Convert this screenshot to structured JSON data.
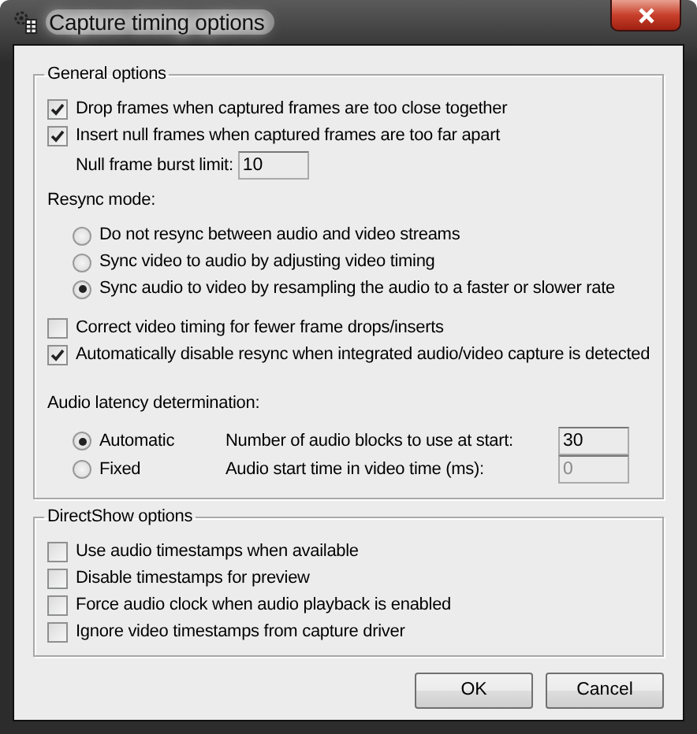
{
  "window": {
    "title": "Capture timing options"
  },
  "general_options": {
    "title": "General options",
    "checkboxes": [
      {
        "label": "Drop frames when captured frames are too close together",
        "checked": true
      },
      {
        "label": "Insert null frames when captured frames are too far apart",
        "checked": true
      }
    ],
    "burst_limit": {
      "label": "Null frame burst limit:",
      "value": "10"
    },
    "resync": {
      "label": "Resync mode:",
      "options": [
        {
          "label": "Do not resync between audio and video streams",
          "selected": false
        },
        {
          "label": "Sync video to audio by adjusting video timing",
          "selected": false
        },
        {
          "label": "Sync audio to video by resampling the audio to a faster or slower rate",
          "selected": true
        }
      ]
    },
    "more_checkboxes": [
      {
        "label": "Correct video timing for fewer frame drops/inserts",
        "checked": false
      },
      {
        "label": "Automatically disable resync when integrated audio/video capture is detected",
        "checked": true
      }
    ],
    "audio_latency": {
      "label": "Audio latency determination:",
      "options": [
        {
          "label": "Automatic",
          "selected": true,
          "field_label": "Number of audio blocks to use at start:",
          "value": "30",
          "disabled": false
        },
        {
          "label": "Fixed",
          "selected": false,
          "field_label": "Audio start time in video time (ms):",
          "value": "0",
          "disabled": true
        }
      ]
    }
  },
  "directshow_options": {
    "title": "DirectShow options",
    "checkboxes": [
      {
        "label": "Use audio timestamps when available",
        "checked": false
      },
      {
        "label": "Disable timestamps for preview",
        "checked": false
      },
      {
        "label": "Force audio clock when audio playback is enabled",
        "checked": false
      },
      {
        "label": "Ignore video timestamps from capture driver",
        "checked": false
      }
    ]
  },
  "buttons": [
    {
      "label": "OK"
    },
    {
      "label": "Cancel"
    }
  ]
}
